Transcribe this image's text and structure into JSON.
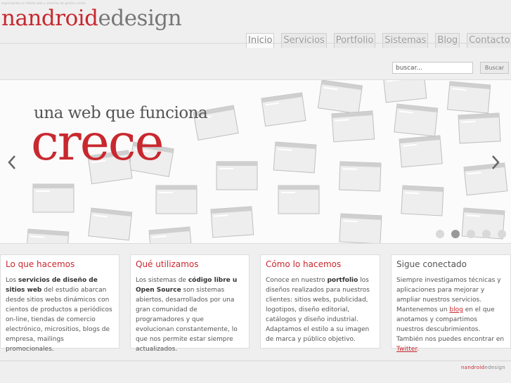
{
  "header": {
    "tagline": "especialistas en diseño web y sistemas de gestion online",
    "logo_part1": "nandroid",
    "logo_part2": "edesign"
  },
  "nav": [
    {
      "label": "Inicio",
      "active": true
    },
    {
      "label": "Servicios",
      "active": false
    },
    {
      "label": "Portfolio",
      "active": false
    },
    {
      "label": "Sistemas",
      "active": false
    },
    {
      "label": "Blog",
      "active": false
    },
    {
      "label": "Contacto",
      "active": false
    }
  ],
  "search": {
    "placeholder": "buscar...",
    "button_label": "Buscar"
  },
  "slider": {
    "headline": "una web que funciona",
    "bigword": "crece",
    "slides_count": 5,
    "active_slide": 2
  },
  "cards": [
    {
      "title": "Lo que hacemos",
      "text_before": "Los ",
      "bold": "servicios de diseño de sitios web",
      "text_after": " del estudio abarcan desde sitios webs dinámicos con cientos de productos a periódicos on-line, tiendas de comercio electrónico, micrositios, blogs de empresa, mailings promocionales."
    },
    {
      "title": "Qué utilizamos",
      "text_before": "Los sistemas de ",
      "bold": "código libre u Open Source",
      "text_after": " son sistemas abiertos, desarrollados por una gran comunidad de programadores y que evolucionan constantemente, lo que nos permite estar siempre actualizados."
    },
    {
      "title": "Cómo lo hacemos",
      "text_before": "Conoce en nuestro ",
      "bold": "portfolio",
      "text_after": " los diseños realizados para nuestros clientes: sitios webs, publicidad, logotipos, diseño editorial, catálogos y diseño industrial. Adaptamos el estilo a su imagen de marca y público objetivo."
    },
    {
      "title": "Sigue conectado",
      "text_before": "Siempre investigamos técnicas y aplicaciones para mejorar y ampliar nuestros servicios. Mantenemos un ",
      "link1": "blog",
      "text_middle": " en el que anotamos y compartimos nuestros descubrimientos. También nos puedes encontrar en ",
      "link2": "Twitter",
      "text_after": "."
    }
  ],
  "footer": {
    "logo_part1": "nandroid",
    "logo_part2": "edesign"
  },
  "colors": {
    "brand_red": "#c8282e",
    "text_grey": "#555555",
    "background": "#efefef"
  }
}
